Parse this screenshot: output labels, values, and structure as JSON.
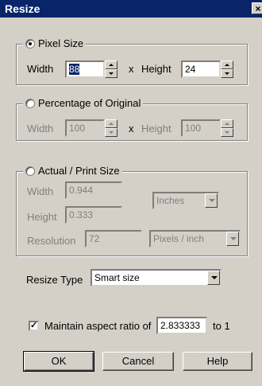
{
  "window": {
    "title": "Resize",
    "close_label": "×"
  },
  "pixel_size": {
    "label": "Pixel Size",
    "selected": true,
    "width_label": "Width",
    "width_value": "88",
    "x_label": "x",
    "height_label": "Height",
    "height_value": "24"
  },
  "percentage": {
    "label": "Percentage of Original",
    "selected": false,
    "width_label": "Width",
    "width_value": "100",
    "x_label": "x",
    "height_label": "Height",
    "height_value": "100"
  },
  "actual_print": {
    "label": "Actual / Print Size",
    "selected": false,
    "width_label": "Width",
    "width_value": "0.944",
    "height_label": "Height",
    "height_value": "0.333",
    "units_value": "Inches",
    "resolution_label": "Resolution",
    "resolution_value": "72",
    "resolution_units_value": "Pixels / inch"
  },
  "resize_type": {
    "label": "Resize Type",
    "value": "Smart size"
  },
  "aspect": {
    "checked": true,
    "label": "Maintain aspect ratio of",
    "value": "2.833333",
    "suffix": "to 1"
  },
  "buttons": {
    "ok": "OK",
    "cancel": "Cancel",
    "help": "Help"
  }
}
